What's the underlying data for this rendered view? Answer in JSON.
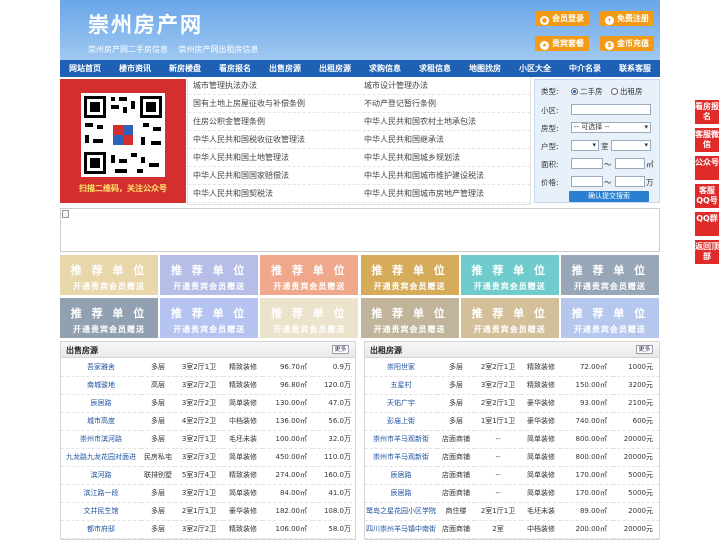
{
  "site": {
    "logo": "崇州房产网",
    "tagline": [
      "崇州房产网二手房信息",
      "崇州房产网出租房信息"
    ]
  },
  "header_buttons": [
    {
      "label": "会员登录",
      "icon": "user-icon"
    },
    {
      "label": "免费注册",
      "icon": "register-icon"
    },
    {
      "label": "贵宾套餐",
      "icon": "vip-icon"
    },
    {
      "label": "金币充值",
      "icon": "coin-icon"
    }
  ],
  "nav": [
    "网站首页",
    "楼市资讯",
    "新房楼盘",
    "看房报名",
    "出售房源",
    "出租房源",
    "求购信息",
    "求租信息",
    "地图找房",
    "小区大全",
    "中介名录",
    "联系客服"
  ],
  "qr_caption": "扫描二维码，关注公众号",
  "links": [
    [
      "城市管理执法办法",
      "城市设计管理办法"
    ],
    [
      "国有土地上房屋征收与补偿条例",
      "不动产登记暂行条例"
    ],
    [
      "住房公积金管理条例",
      "中华人民共和国农村土地承包法"
    ],
    [
      "中华人民共和国税收征收管理法",
      "中华人民共和国继承法"
    ],
    [
      "中华人民共和国土地管理法",
      "中华人民共和国城乡规划法"
    ],
    [
      "中华人民共和国国家赔偿法",
      "中华人民共和国城市维护建设税法"
    ],
    [
      "中华人民共和国契税法",
      "中华人民共和国城市房地产管理法"
    ]
  ],
  "search": {
    "type_label": "类型:",
    "opt_sale": "二手房",
    "opt_rent": "出租房",
    "community_label": "小区:",
    "house_label": "房型:",
    "house_value": "-- 可选择 --",
    "layout_label": "户型:",
    "room_unit": "室",
    "area_label": "面积:",
    "area_unit": "㎡",
    "price_label": "价格:",
    "price_unit": "万",
    "range_sep": "～",
    "submit": "确认提交搜索"
  },
  "tile_text": {
    "t1": "推 荐 单 位",
    "t2": "开通贵宾会员赠送"
  },
  "tile_colors": [
    "#e9d7ac",
    "#b6bde6",
    "#f0a88c",
    "#d6ac5b",
    "#6fcbcc",
    "#97a7b7",
    "#91a1b1",
    "#b4c3f0",
    "#ece3cc",
    "#c0b49a",
    "#d3bf9a",
    "#b6c7ee"
  ],
  "sale": {
    "title": "出售房源",
    "more": "更多",
    "rows": [
      [
        "吾家雅舍",
        "多层",
        "3室2厅1卫",
        "精致装修",
        "96.70㎡",
        "0.9万"
      ],
      [
        "南城骏地",
        "高层",
        "3室2厅2卫",
        "精致装修",
        "96.80㎡",
        "120.0万"
      ],
      [
        "辰居路",
        "多层",
        "3室2厅2卫",
        "简单装修",
        "130.00㎡",
        "47.0万"
      ],
      [
        "城市高度",
        "多层",
        "4室2厅2卫",
        "中档装修",
        "136.00㎡",
        "56.0万"
      ],
      [
        "崇州市滨河路",
        "多层",
        "3室2厅1卫",
        "毛坯未装",
        "100.00㎡",
        "32.0万"
      ],
      [
        "九龙路九龙花园对面进",
        "民房私宅",
        "3室2厅3卫",
        "简单装修",
        "450.00㎡",
        "110.0万"
      ],
      [
        "滨河路",
        "联排别墅",
        "5室3厅4卫",
        "精致装修",
        "274.00㎡",
        "160.0万"
      ],
      [
        "滨江路一段",
        "多层",
        "3室2厅1卫",
        "简单装修",
        "84.00㎡",
        "41.0万"
      ],
      [
        "文井民生馆",
        "多层",
        "2室1厅1卫",
        "豪华装修",
        "182.00㎡",
        "108.0万"
      ],
      [
        "都市府邸",
        "多层",
        "3室2厅2卫",
        "精致装修",
        "106.00㎡",
        "58.0万"
      ]
    ]
  },
  "rent": {
    "title": "出租房源",
    "more": "更多",
    "rows": [
      [
        "崇阳世家",
        "多层",
        "2室2厅1卫",
        "精致装修",
        "72.00㎡",
        "1000元"
      ],
      [
        "五星村",
        "多层",
        "3室2厅2卫",
        "精致装修",
        "150.00㎡",
        "3200元"
      ],
      [
        "天佑广宇",
        "多层",
        "2室2厅1卫",
        "豪华装修",
        "93.00㎡",
        "2100元"
      ],
      [
        "彭庙上街",
        "多层",
        "1室1厅1卫",
        "豪华装修",
        "740.00㎡",
        "600元"
      ],
      [
        "崇州市羊马观新街",
        "店面商铺",
        "--",
        "简单装修",
        "800.00㎡",
        "20000元"
      ],
      [
        "崇州市羊马观新街",
        "店面商铺",
        "--",
        "简单装修",
        "800.00㎡",
        "20000元"
      ],
      [
        "辰居路",
        "店面商铺",
        "--",
        "简单装修",
        "170.00㎡",
        "5000元"
      ],
      [
        "辰居路",
        "店面商铺",
        "--",
        "简单装修",
        "170.00㎡",
        "5000元"
      ],
      [
        "鹭岛之星花园小区学院",
        "商住楼",
        "2室1厅1卫",
        "毛坯未装",
        "89.00㎡",
        "2000元"
      ],
      [
        "四川崇州羊马镇中南街",
        "店面商铺",
        "2室",
        "中档装修",
        "200.00㎡",
        "20000元"
      ]
    ]
  },
  "side_links": [
    "看房报名",
    "客服微信",
    "公众号",
    "客服QQ号",
    "QQ群",
    "返回顶部"
  ]
}
